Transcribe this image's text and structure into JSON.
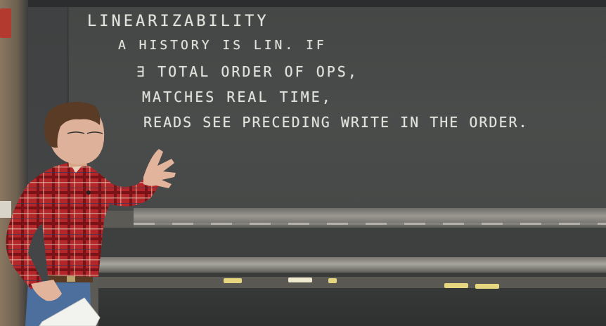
{
  "chalkboard": {
    "lines": [
      "LINEARIZABILITY",
      "A HISTORY IS LIN. IF",
      "∃ TOTAL ORDER OF OPS,",
      "MATCHES REAL TIME,",
      "READS SEE PRECEDING WRITE IN THE ORDER."
    ]
  },
  "colors": {
    "chalkboard": "#474948",
    "chalk_text": "#efefe9",
    "shirt_red": "#b3262a",
    "jeans": "#4c6f9e"
  }
}
